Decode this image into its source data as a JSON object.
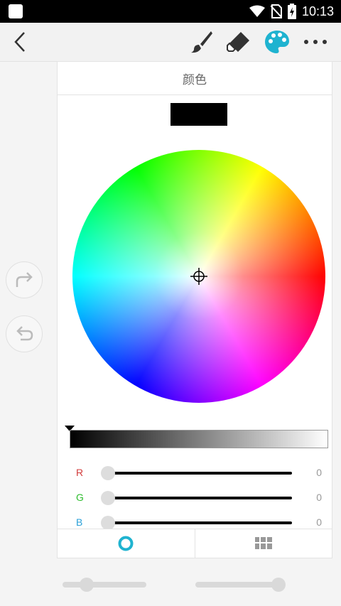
{
  "status_bar": {
    "time": "10:13",
    "icons": [
      "app-square-icon",
      "wifi-icon",
      "no-sim-icon",
      "battery-charging-icon"
    ]
  },
  "toolbar": {
    "back_icon": "chevron-left-icon",
    "tools": [
      "brush-icon",
      "eraser-icon",
      "palette-icon",
      "more-icon"
    ],
    "active_tool": "palette-icon",
    "accent_color": "#1fb3d0"
  },
  "side_buttons": [
    "redo-icon",
    "undo-icon"
  ],
  "color_panel": {
    "title": "颜色",
    "current_color": "#000000",
    "brightness": 0,
    "rgb": [
      {
        "label": "R",
        "value": "0",
        "color": "#d23c3c"
      },
      {
        "label": "G",
        "value": "0",
        "color": "#2ebd2e"
      },
      {
        "label": "B",
        "value": "0",
        "color": "#2aa0d8"
      }
    ],
    "tabs": [
      "color-wheel-icon",
      "swatch-grid-icon"
    ],
    "active_tab": "color-wheel-icon"
  },
  "bottom_sliders": [
    {
      "name": "brush-size-slider",
      "level": 0.2
    },
    {
      "name": "brush-opacity-slider",
      "level": 1.0
    }
  ]
}
